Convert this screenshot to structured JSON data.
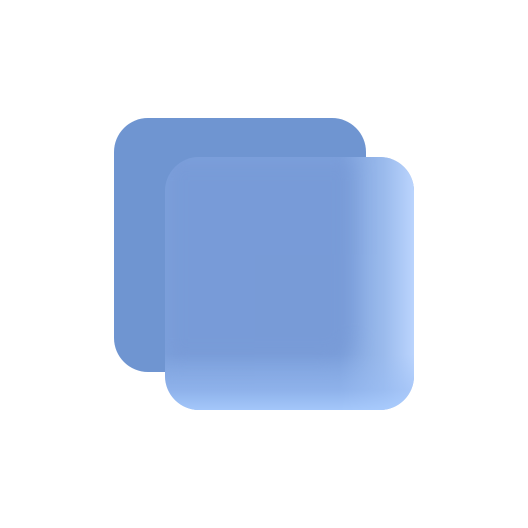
{
  "icon": {
    "name": "copy-icon",
    "colors": {
      "back": "#6f95d1",
      "front": "#7ea2dd",
      "highlight": "#bcd6ff"
    }
  }
}
